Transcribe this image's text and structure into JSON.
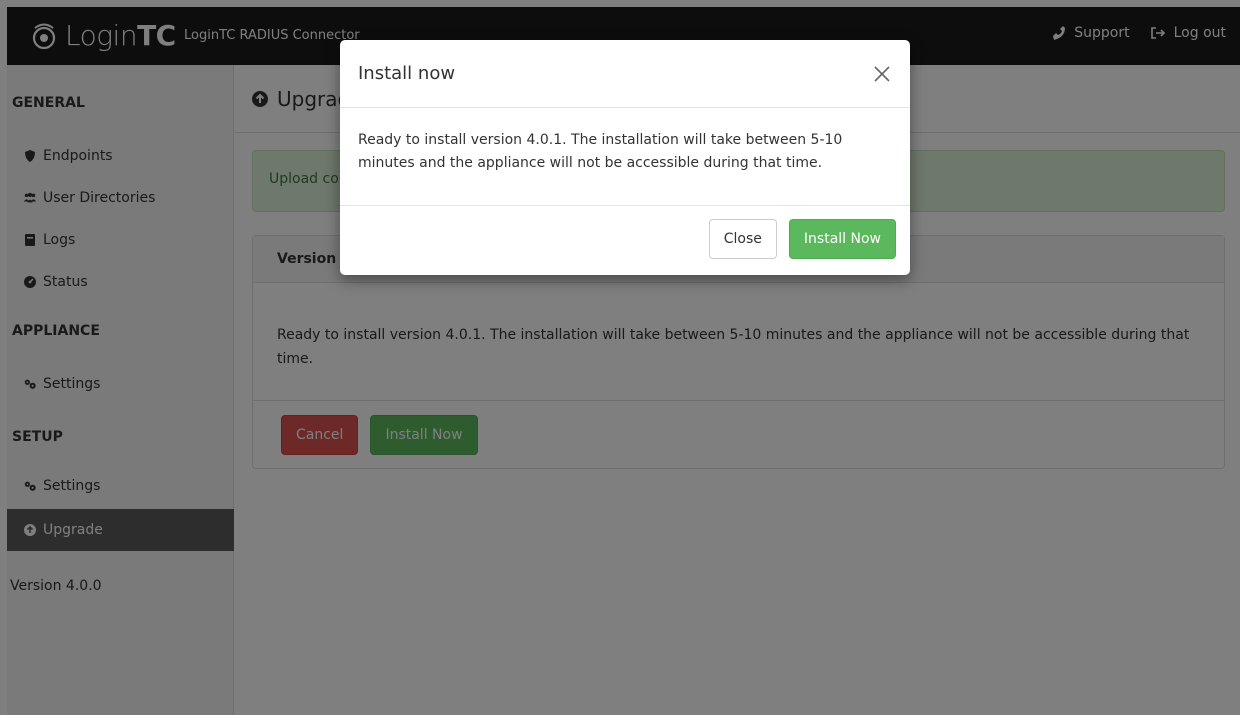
{
  "navbar": {
    "brand_light": "Login",
    "brand_bold": "TC",
    "product": "LoginTC RADIUS Connector",
    "support_label": "Support",
    "logout_label": "Log out"
  },
  "sidebar": {
    "general_heading": "GENERAL",
    "items_general": [
      {
        "label": "Endpoints",
        "icon": "shield-icon"
      },
      {
        "label": "User Directories",
        "icon": "users-icon"
      },
      {
        "label": "Logs",
        "icon": "book-icon"
      },
      {
        "label": "Status",
        "icon": "dashboard-icon"
      }
    ],
    "appliance_heading": "APPLIANCE",
    "appliance_settings": "Settings",
    "setup_heading": "SETUP",
    "setup_settings": "Settings",
    "upgrade": "Upgrade",
    "version": "Version 4.0.0"
  },
  "main": {
    "title": "Upgrade",
    "alert_text": "Upload co",
    "panel_head": "Version 4",
    "panel_body": "Ready to install version 4.0.1. The installation will take between 5-10 minutes and the appliance will not be accessible during that time.",
    "cancel_label": "Cancel",
    "install_label": "Install Now"
  },
  "modal": {
    "title": "Install now",
    "body": "Ready to install version 4.0.1. The installation will take between 5-10 minutes and the appliance will not be accessible during that time.",
    "close_label": "Close",
    "install_label": "Install Now"
  },
  "colors": {
    "navbar": "#1a1a1a",
    "sidebar_active": "#5b5b5b",
    "success": "#5cb85c",
    "danger": "#d9534f",
    "alert_bg": "#dff0d8"
  }
}
